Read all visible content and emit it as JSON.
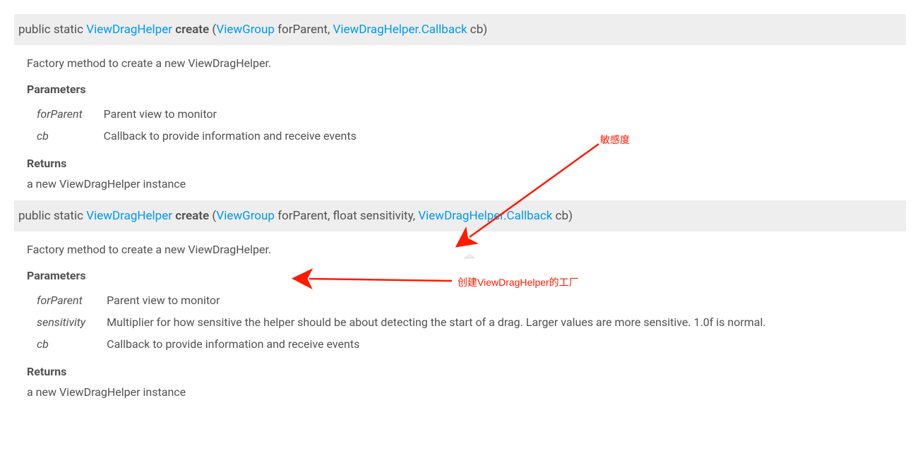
{
  "methods": [
    {
      "signature": {
        "prefix": "public static ",
        "return_type": "ViewDragHelper",
        "name": "create",
        "open": " (",
        "params": [
          {
            "type_link": "ViewGroup",
            "text": " forParent, "
          },
          {
            "type_link": "ViewDragHelper.Callback",
            "text": " cb)"
          }
        ]
      },
      "description": "Factory method to create a new ViewDragHelper.",
      "params_heading": "Parameters",
      "params": [
        {
          "name": "forParent",
          "desc": "Parent view to monitor"
        },
        {
          "name": "cb",
          "desc": "Callback to provide information and receive events"
        }
      ],
      "returns_heading": "Returns",
      "returns_text": "a new ViewDragHelper instance"
    },
    {
      "signature": {
        "prefix": "public static ",
        "return_type": "ViewDragHelper",
        "name": "create",
        "open": " (",
        "params": [
          {
            "type_link": "ViewGroup",
            "text": " forParent, float sensitivity, "
          },
          {
            "type_link": "ViewDragHelper.Callback",
            "text": " cb)"
          }
        ]
      },
      "description": "Factory method to create a new ViewDragHelper.",
      "params_heading": "Parameters",
      "params": [
        {
          "name": "forParent",
          "desc": "Parent view to monitor"
        },
        {
          "name": "sensitivity",
          "desc": "Multiplier for how sensitive the helper should be about detecting the start of a drag. Larger values are more sensitive. 1.0f is normal."
        },
        {
          "name": "cb",
          "desc": "Callback to provide information and receive events"
        }
      ],
      "returns_heading": "Returns",
      "returns_text": "a new ViewDragHelper instance"
    }
  ],
  "annotations": {
    "label1": "敏感度",
    "label2": "创建ViewDragHelper的工厂"
  }
}
